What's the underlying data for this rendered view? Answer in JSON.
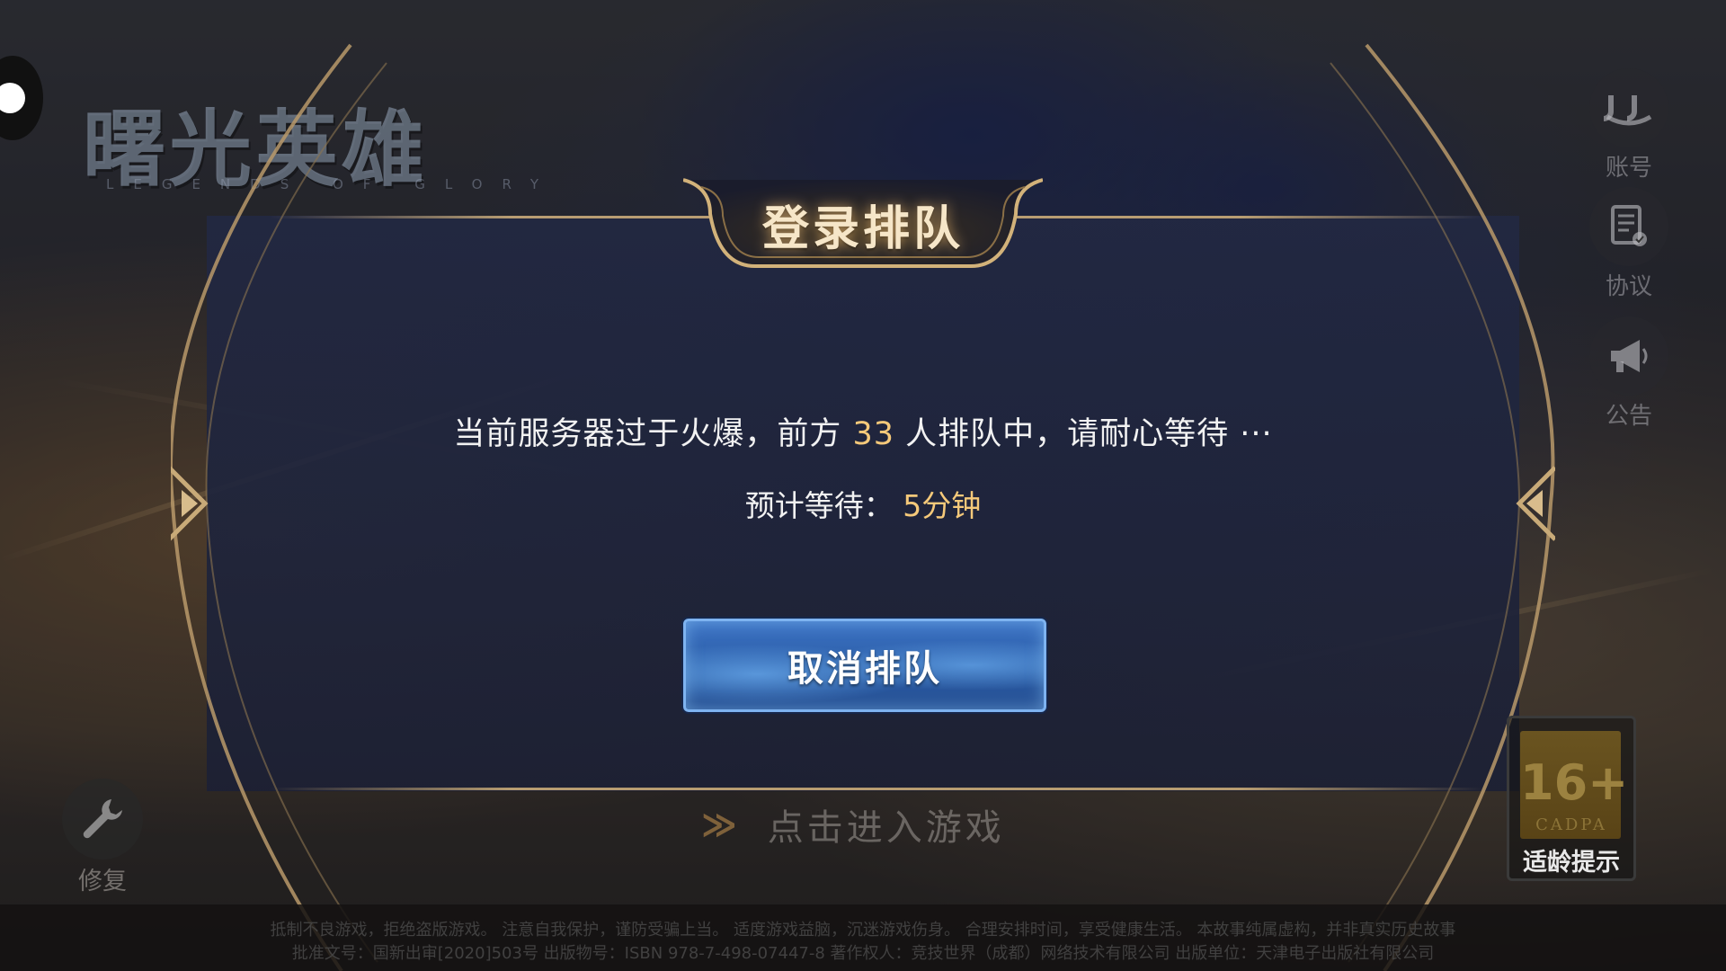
{
  "logo": {
    "title": "曙光英雄",
    "subtitle": "LEGENDS OF GLORY"
  },
  "side_buttons": [
    {
      "name": "account",
      "label": "账号",
      "icon": "jj-account-icon"
    },
    {
      "name": "agreement",
      "label": "协议",
      "icon": "document-check-icon"
    },
    {
      "name": "notice",
      "label": "公告",
      "icon": "megaphone-icon"
    }
  ],
  "dialog": {
    "title": "登录排队",
    "message_prefix": "当前服务器过于火爆，前方",
    "queue_count": "33",
    "message_suffix": "人排队中，请耐心等待 ···",
    "wait_label": "预计等待：",
    "wait_value": "5分钟",
    "cancel_label": "取消排队"
  },
  "enter_game_label": "点击进入游戏",
  "repair_label": "修复",
  "age_rating": {
    "number": "16+",
    "org": "CADPA",
    "label": "适龄提示"
  },
  "footer": {
    "line1": "抵制不良游戏，拒绝盗版游戏。 注意自我保护，谨防受骗上当。 适度游戏益脑，沉迷游戏伤身。 合理安排时间，享受健康生活。 本故事纯属虚构，并非真实历史故事",
    "line2": "批准文号：国新出审[2020]503号 出版物号：ISBN 978-7-498-07447-8 著作权人：竞技世界（成都）网络技术有限公司 出版单位：天津电子出版社有限公司"
  },
  "colors": {
    "highlight": "#f5c97a",
    "gold_frame": "#c8aa78",
    "button_blue": "#2c5ea8"
  }
}
